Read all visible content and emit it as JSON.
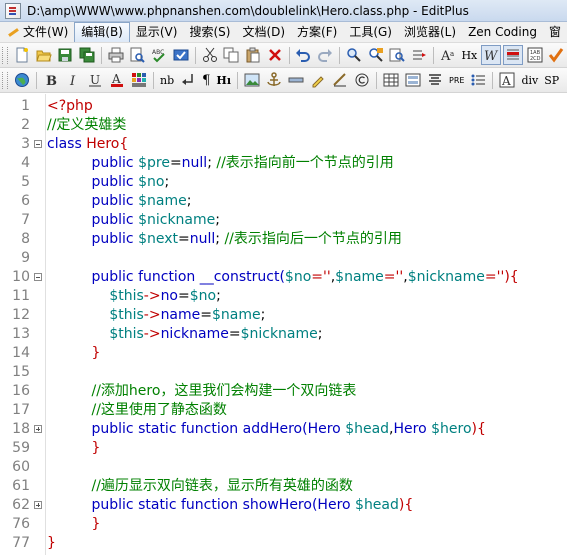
{
  "window": {
    "title": "D:\\amp\\WWW\\www.phpnanshen.com\\doublelink\\Hero.class.php - EditPlus"
  },
  "menu": [
    {
      "label": "文件(W)"
    },
    {
      "label": "编辑(B)"
    },
    {
      "label": "显示(V)"
    },
    {
      "label": "搜索(S)"
    },
    {
      "label": "文档(D)"
    },
    {
      "label": "方案(F)"
    },
    {
      "label": "工具(G)"
    },
    {
      "label": "浏览器(L)"
    },
    {
      "label": "Zen Coding"
    },
    {
      "label": "窗"
    }
  ],
  "toolbar2": {
    "nb": "nb",
    "para": "¶",
    "h": "Hı",
    "pre": "PRE",
    "div": "div",
    "sp": "SP"
  },
  "toolbar1": {
    "hx": "Hx",
    "abc": "ABC"
  },
  "code": [
    {
      "ln": "1",
      "fold": "",
      "tokens": [
        {
          "t": "<?php",
          "c": "php"
        }
      ]
    },
    {
      "ln": "2",
      "fold": "",
      "tokens": [
        {
          "t": "//定义英雄类",
          "c": "cm"
        }
      ]
    },
    {
      "ln": "3",
      "fold": "minus",
      "tokens": [
        {
          "t": "class ",
          "c": "kw"
        },
        {
          "t": "Hero",
          "c": "str"
        },
        {
          "t": "{",
          "c": "str"
        }
      ]
    },
    {
      "ln": "4",
      "fold": "",
      "tokens": [
        {
          "t": "          public ",
          "c": "kw"
        },
        {
          "t": "$pre",
          "c": "var"
        },
        {
          "t": "=",
          "c": "op"
        },
        {
          "t": "null",
          "c": "kw"
        },
        {
          "t": "; ",
          "c": "op"
        },
        {
          "t": "//表示指向前一个节点的引用",
          "c": "cm"
        }
      ]
    },
    {
      "ln": "5",
      "fold": "",
      "tokens": [
        {
          "t": "          public ",
          "c": "kw"
        },
        {
          "t": "$no",
          "c": "var"
        },
        {
          "t": ";",
          "c": "op"
        }
      ]
    },
    {
      "ln": "6",
      "fold": "",
      "tokens": [
        {
          "t": "          public ",
          "c": "kw"
        },
        {
          "t": "$name",
          "c": "var"
        },
        {
          "t": ";",
          "c": "op"
        }
      ]
    },
    {
      "ln": "7",
      "fold": "",
      "tokens": [
        {
          "t": "          public ",
          "c": "kw"
        },
        {
          "t": "$nickname",
          "c": "var"
        },
        {
          "t": ";",
          "c": "op"
        }
      ]
    },
    {
      "ln": "8",
      "fold": "",
      "tokens": [
        {
          "t": "          public ",
          "c": "kw"
        },
        {
          "t": "$next",
          "c": "var"
        },
        {
          "t": "=",
          "c": "op"
        },
        {
          "t": "null",
          "c": "kw"
        },
        {
          "t": "; ",
          "c": "op"
        },
        {
          "t": "//表示指向后一个节点的引用",
          "c": "cm"
        }
      ]
    },
    {
      "ln": "9",
      "fold": "",
      "tokens": []
    },
    {
      "ln": "10",
      "fold": "minus",
      "tokens": [
        {
          "t": "          public function ",
          "c": "kw"
        },
        {
          "t": "__construct(",
          "c": "kw"
        },
        {
          "t": "$no",
          "c": "var"
        },
        {
          "t": "=''",
          "c": "str"
        },
        {
          "t": ",",
          "c": "op"
        },
        {
          "t": "$name",
          "c": "var"
        },
        {
          "t": "=''",
          "c": "str"
        },
        {
          "t": ",",
          "c": "op"
        },
        {
          "t": "$nickname",
          "c": "var"
        },
        {
          "t": "=''",
          "c": "str"
        },
        {
          "t": "){",
          "c": "str"
        }
      ]
    },
    {
      "ln": "11",
      "fold": "",
      "tokens": [
        {
          "t": "              ",
          "c": "op"
        },
        {
          "t": "$this",
          "c": "var"
        },
        {
          "t": "->",
          "c": "str"
        },
        {
          "t": "no",
          "c": "kw"
        },
        {
          "t": "=",
          "c": "op"
        },
        {
          "t": "$no",
          "c": "var"
        },
        {
          "t": ";",
          "c": "op"
        }
      ]
    },
    {
      "ln": "12",
      "fold": "",
      "tokens": [
        {
          "t": "              ",
          "c": "op"
        },
        {
          "t": "$this",
          "c": "var"
        },
        {
          "t": "->",
          "c": "str"
        },
        {
          "t": "name",
          "c": "kw"
        },
        {
          "t": "=",
          "c": "op"
        },
        {
          "t": "$name",
          "c": "var"
        },
        {
          "t": ";",
          "c": "op"
        }
      ]
    },
    {
      "ln": "13",
      "fold": "",
      "tokens": [
        {
          "t": "              ",
          "c": "op"
        },
        {
          "t": "$this",
          "c": "var"
        },
        {
          "t": "->",
          "c": "str"
        },
        {
          "t": "nickname",
          "c": "kw"
        },
        {
          "t": "=",
          "c": "op"
        },
        {
          "t": "$nickname",
          "c": "var"
        },
        {
          "t": ";",
          "c": "op"
        }
      ]
    },
    {
      "ln": "14",
      "fold": "",
      "tokens": [
        {
          "t": "          }",
          "c": "str"
        }
      ]
    },
    {
      "ln": "15",
      "fold": "",
      "tokens": []
    },
    {
      "ln": "16",
      "fold": "",
      "tokens": [
        {
          "t": "          //添加hero，这里我们会构建一个双向链表",
          "c": "cm"
        }
      ]
    },
    {
      "ln": "17",
      "fold": "",
      "tokens": [
        {
          "t": "          //这里使用了静态函数",
          "c": "cm"
        }
      ]
    },
    {
      "ln": "18",
      "fold": "plus",
      "tokens": [
        {
          "t": "          public static function ",
          "c": "kw"
        },
        {
          "t": "addHero(",
          "c": "kw"
        },
        {
          "t": "Hero ",
          "c": "kw"
        },
        {
          "t": "$head",
          "c": "var"
        },
        {
          "t": ",",
          "c": "op"
        },
        {
          "t": "Hero ",
          "c": "kw"
        },
        {
          "t": "$hero",
          "c": "var"
        },
        {
          "t": "){",
          "c": "str"
        }
      ]
    },
    {
      "ln": "59",
      "fold": "",
      "tokens": [
        {
          "t": "          }",
          "c": "str"
        }
      ]
    },
    {
      "ln": "60",
      "fold": "",
      "tokens": []
    },
    {
      "ln": "61",
      "fold": "",
      "tokens": [
        {
          "t": "          //遍历显示双向链表，显示所有英雄的函数",
          "c": "cm"
        }
      ]
    },
    {
      "ln": "62",
      "fold": "plus",
      "tokens": [
        {
          "t": "          public static function ",
          "c": "kw"
        },
        {
          "t": "showHero(",
          "c": "kw"
        },
        {
          "t": "Hero ",
          "c": "kw"
        },
        {
          "t": "$head",
          "c": "var"
        },
        {
          "t": "){",
          "c": "str"
        }
      ]
    },
    {
      "ln": "76",
      "fold": "",
      "tokens": [
        {
          "t": "          }",
          "c": "str"
        }
      ]
    },
    {
      "ln": "77",
      "fold": "",
      "tokens": [
        {
          "t": "}",
          "c": "str"
        }
      ]
    }
  ]
}
